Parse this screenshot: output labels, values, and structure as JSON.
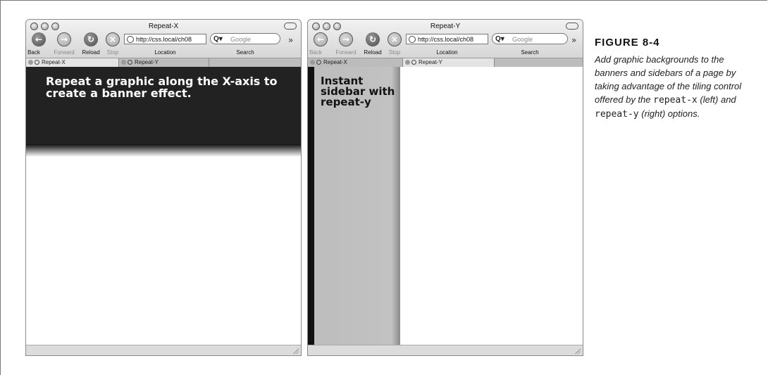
{
  "left_window": {
    "title": "Repeat-X",
    "toolbar": {
      "back": "Back",
      "forward": "Forward",
      "reload": "Reload",
      "stop": "Stop",
      "location": "Location",
      "search": "Search"
    },
    "url": "http://css.local/ch08",
    "search_placeholder": "Google",
    "tabs": [
      "Repeat-X",
      "Repeat-Y"
    ],
    "active_tab": 0,
    "content_text": "Repeat a graphic along the X-axis to create a banner effect."
  },
  "right_window": {
    "title": "Repeat-Y",
    "toolbar": {
      "back": "Back",
      "forward": "Forward",
      "reload": "Reload",
      "stop": "Stop",
      "location": "Location",
      "search": "Search"
    },
    "url": "http://css.local/ch08",
    "search_placeholder": "Google",
    "tabs": [
      "Repeat-X",
      "Repeat-Y"
    ],
    "active_tab": 1,
    "content_text": "Instant sidebar with repeat-y"
  },
  "caption": {
    "title": "FIGURE 8-4",
    "body_1": "Add graphic backgrounds to the banners and sidebars of a page by taking advantage of the tiling control offered by the ",
    "code_1": "repeat-x",
    "body_2": " (left) and ",
    "code_2": "repeat-y",
    "body_3": " (right) options."
  }
}
